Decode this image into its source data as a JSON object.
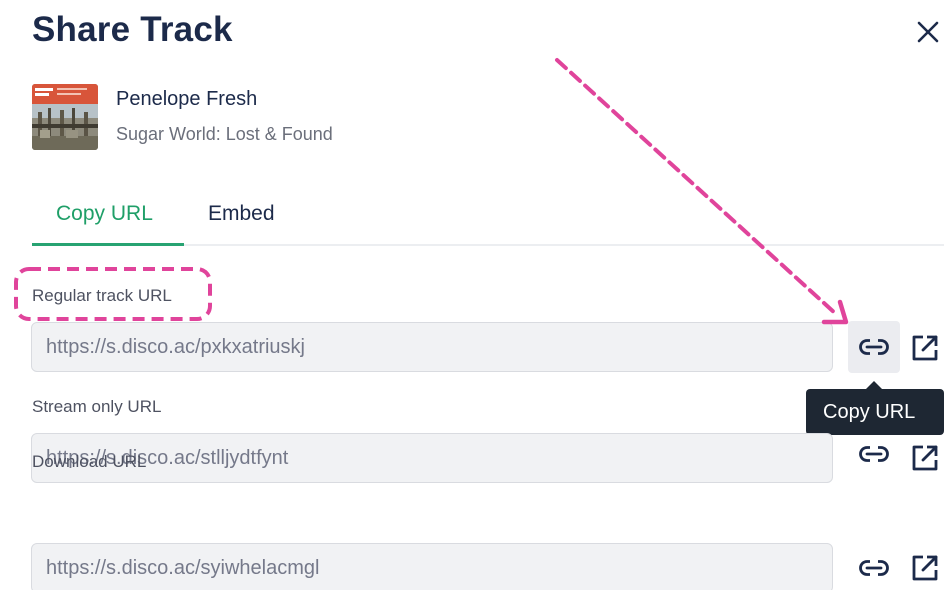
{
  "dialog": {
    "title": "Share Track",
    "close_icon": "close-icon"
  },
  "track": {
    "artist": "Penelope Fresh",
    "album": "Sugar World: Lost & Found",
    "cover_icon": "album-cover"
  },
  "tabs": [
    {
      "label": "Copy URL",
      "active": true
    },
    {
      "label": "Embed",
      "active": false
    }
  ],
  "urls": [
    {
      "label": "Regular track URL",
      "value": "https://s.disco.ac/pxkxatriuskj"
    },
    {
      "label": "Stream only URL",
      "value": "https://s.disco.ac/stlljydtfynt"
    },
    {
      "label": "Download URL",
      "value": "https://s.disco.ac/syiwhelacmgl"
    }
  ],
  "tooltip": {
    "text": "Copy URL"
  },
  "icons": {
    "copy": "link-icon",
    "open": "external-link-icon"
  },
  "colors": {
    "accent_green": "#27a372",
    "title_navy": "#1c2a4a",
    "annotation_pink": "#e0449b",
    "tooltip_bg": "#1e2733",
    "field_bg": "#f1f2f4"
  }
}
